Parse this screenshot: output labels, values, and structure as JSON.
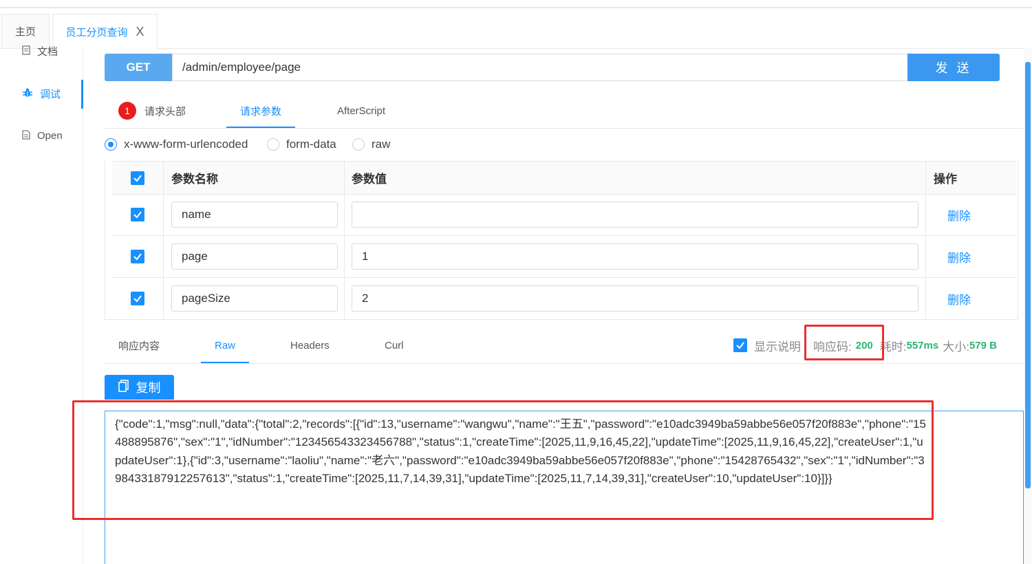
{
  "tabs": {
    "home": "主页",
    "active": "员工分页查询",
    "close": "X"
  },
  "sidebar": {
    "items": [
      {
        "label": "文档",
        "icon": "doc-icon"
      },
      {
        "label": "调试",
        "icon": "bug-icon"
      },
      {
        "label": "Open",
        "icon": "file-icon"
      }
    ]
  },
  "request": {
    "method": "GET",
    "url": "/admin/employee/page",
    "send_label": "发 送"
  },
  "request_tabs": {
    "headers_badge": "1",
    "headers": "请求头部",
    "params": "请求参数",
    "afterscript": "AfterScript"
  },
  "body_types": {
    "options": [
      "x-www-form-urlencoded",
      "form-data",
      "raw"
    ],
    "selected": "x-www-form-urlencoded"
  },
  "params_table": {
    "headers": {
      "name": "参数名称",
      "value": "参数值",
      "action": "操作"
    },
    "rows": [
      {
        "checked": true,
        "name": "name",
        "value": "",
        "action": "删除"
      },
      {
        "checked": true,
        "name": "page",
        "value": "1",
        "action": "删除"
      },
      {
        "checked": true,
        "name": "pageSize",
        "value": "2",
        "action": "删除"
      }
    ]
  },
  "response_tabs": {
    "content": "响应内容",
    "raw": "Raw",
    "headers": "Headers",
    "curl": "Curl"
  },
  "response_meta": {
    "show_desc_label": "显示说明",
    "show_desc_checked": true,
    "code_label": "响应码:",
    "code": "200",
    "time_label": "耗时:",
    "time": "557ms",
    "size_label": "大小:",
    "size": "579 B"
  },
  "copy_label": "复制",
  "raw_response": "{\"code\":1,\"msg\":null,\"data\":{\"total\":2,\"records\":[{\"id\":13,\"username\":\"wangwu\",\"name\":\"王五\",\"password\":\"e10adc3949ba59abbe56e057f20f883e\",\"phone\":\"15488895876\",\"sex\":\"1\",\"idNumber\":\"123456543323456788\",\"status\":1,\"createTime\":[2025,11,9,16,45,22],\"updateTime\":[2025,11,9,16,45,22],\"createUser\":1,\"updateUser\":1},{\"id\":3,\"username\":\"laoliu\",\"name\":\"老六\",\"password\":\"e10adc3949ba59abbe56e057f20f883e\",\"phone\":\"15428765432\",\"sex\":\"1\",\"idNumber\":\"398433187912257613\",\"status\":1,\"createTime\":[2025,11,7,14,39,31],\"updateTime\":[2025,11,7,14,39,31],\"createUser\":10,\"updateUser\":10}]}}",
  "colors": {
    "accent": "#1890ff",
    "method_bg": "#5aa9f0",
    "highlight": "#ea2f2f",
    "success": "#2bb473",
    "badge": "#ea1c1c"
  }
}
